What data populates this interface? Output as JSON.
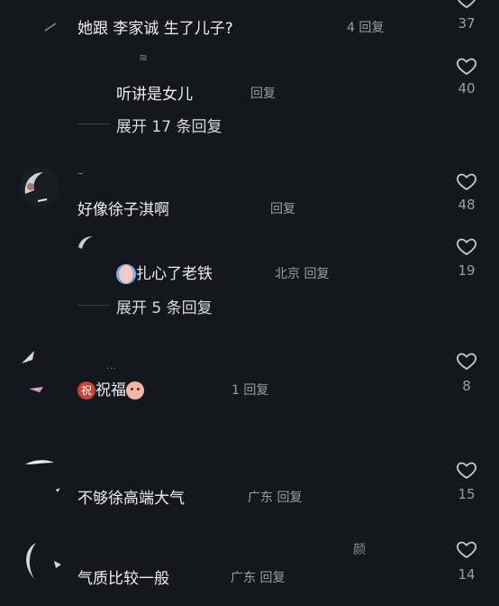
{
  "comments": [
    {
      "text": "她跟 李家诚 生了儿子?",
      "meta": "4 回复",
      "likes": "37"
    },
    {
      "text": "听讲是女儿",
      "meta": "回复",
      "likes": "40",
      "expand": "展开 17 条回复"
    },
    {
      "text": "好像徐子淇啊",
      "meta": "回复",
      "likes": "48"
    },
    {
      "text": "扎心了老铁",
      "meta": "北京 回复",
      "likes": "19",
      "expand": "展开 5 条回复"
    },
    {
      "text": "祝福",
      "badge": "祝",
      "meta": "1 回复",
      "likes": "8"
    },
    {
      "text": "不够徐高端大气",
      "meta": "广东 回复",
      "likes": "15"
    },
    {
      "text": "气质比较一般",
      "meta": "广东 回复",
      "likes": "14",
      "username": "颜"
    }
  ],
  "colors": {
    "background": "#16161e",
    "text": "#ededf0",
    "meta": "#8b8b93"
  },
  "icons": [
    "heart-icon"
  ]
}
